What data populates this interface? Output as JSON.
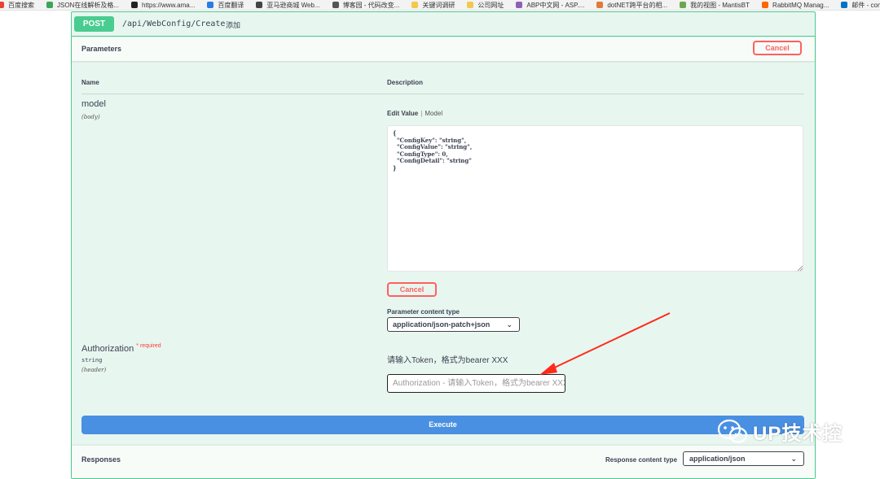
{
  "bookmarks": [
    {
      "label": "百度搜索",
      "color": "#e94235"
    },
    {
      "label": "JSON在线解析及格...",
      "color": "#3aa757"
    },
    {
      "label": "https://www.ama...",
      "color": "#222222"
    },
    {
      "label": "百度翻译",
      "color": "#2a7de1"
    },
    {
      "label": "亚马逊商城 Web...",
      "color": "#444444"
    },
    {
      "label": "博客园 - 代码改变...",
      "color": "#555555"
    },
    {
      "label": "关键词调研",
      "color": "#f2c94c"
    },
    {
      "label": "公司网址",
      "color": "#f2c94c"
    },
    {
      "label": "ABP中文网 - ASP....",
      "color": "#8e5fb8"
    },
    {
      "label": "dotNET跨平台的相...",
      "color": "#e07b39"
    },
    {
      "label": "我的视图 - MantisBT",
      "color": "#6aa84f"
    },
    {
      "label": "RabbitMQ Manag...",
      "color": "#ff6600"
    },
    {
      "label": "邮件 - conanl@...",
      "color": "#0072c6"
    }
  ],
  "operation": {
    "method": "POST",
    "path": "/api/WebConfig/Create",
    "summary": "添加"
  },
  "parameters": {
    "title": "Parameters",
    "cancel_label": "Cancel",
    "col_name": "Name",
    "col_description": "Description"
  },
  "model_param": {
    "name": "model",
    "location": "(body)",
    "tab_edit": "Edit Value",
    "tab_separator": "|",
    "tab_model": "Model",
    "body_value": "{\n  \"ConfigKey\": \"string\",\n  \"ConfigValue\": \"string\",\n  \"ConfigType\": 0,\n  \"ConfigDetail\": \"string\"\n}",
    "cancel_label": "Cancel",
    "content_type_label": "Parameter content type",
    "content_type_value": "application/json-patch+json"
  },
  "auth_param": {
    "name": "Authorization",
    "required_star": "*",
    "required_label": "required",
    "type": "string",
    "location": "(header)",
    "description": "请输入Token，格式为bearer XXX",
    "placeholder": "Authorization - 请输入Token，格式为bearer XXX"
  },
  "execute_label": "Execute",
  "responses": {
    "title": "Responses",
    "content_type_label": "Response content type",
    "content_type_value": "application/json"
  },
  "watermark": {
    "text": "UP技术控",
    "icon": "wechat-icon"
  },
  "annotation": {
    "color": "#ff2a1a"
  },
  "colors": {
    "post": "#49cc90",
    "execute": "#4990e2",
    "cancel": "#ff6060",
    "block_bg": "#e8f6f0"
  }
}
